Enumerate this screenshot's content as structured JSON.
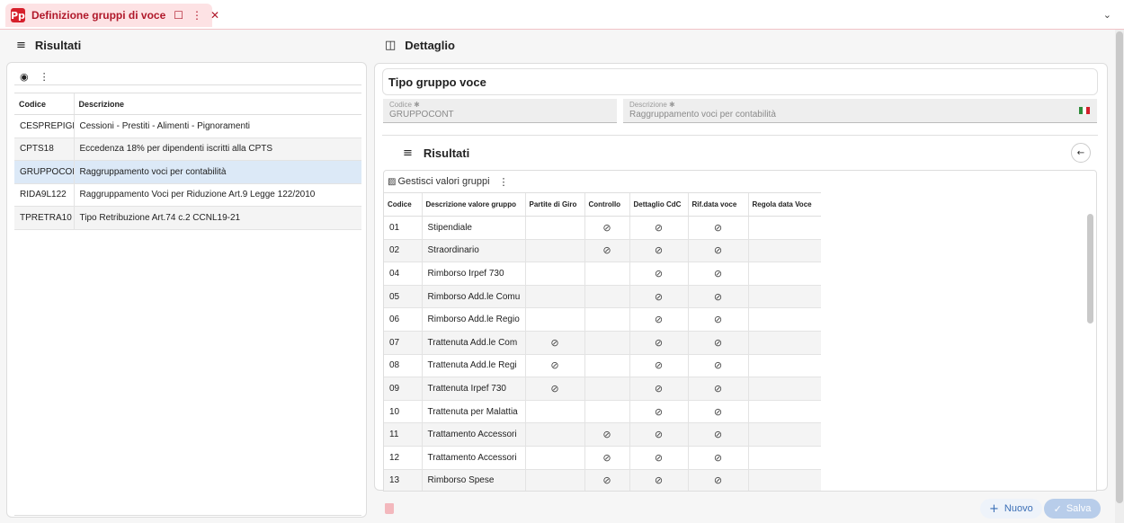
{
  "tab": {
    "logo": "Pp",
    "title": "Definizione gruppi di voce",
    "bookmark_icon": "bookmark-icon",
    "menu_icon": "more-vert-icon",
    "close_icon": "close-icon"
  },
  "left_pane": {
    "title": "Risultati",
    "columns": [
      "Codice",
      "Descrizione"
    ],
    "rows": [
      {
        "codice": "CESPREPIGN",
        "descrizione": "Cessioni - Prestiti - Alimenti - Pignoramenti"
      },
      {
        "codice": "CPTS18",
        "descrizione": "Eccedenza 18% per dipendenti iscritti alla CPTS"
      },
      {
        "codice": "GRUPPOCONT",
        "descrizione": "Raggruppamento voci per contabilità"
      },
      {
        "codice": "RIDA9L122",
        "descrizione": "Raggruppamento Voci per Riduzione Art.9 Legge 122/2010"
      },
      {
        "codice": "TPRETRA10",
        "descrizione": "Tipo Retribuzione Art.74 c.2 CCNL19-21"
      }
    ],
    "selected_index": 2
  },
  "detail_pane": {
    "title": "Dettaglio",
    "section_title": "Tipo gruppo voce",
    "codice_label": "Codice ✱",
    "codice_value": "GRUPPOCONT",
    "descrizione_label": "Descrizione ✱",
    "descrizione_value": "Raggruppamento voci per contabilità"
  },
  "results": {
    "title": "Risultati",
    "manage_label": "Gestisci valori gruppi",
    "columns": [
      "Codice",
      "Descrizione valore gruppo",
      "Partite di Giro",
      "Controllo",
      "Dettaglio CdC",
      "Rif.data voce",
      "Regola data Voce"
    ],
    "rows": [
      {
        "codice": "01",
        "descrizione": "Stipendiale",
        "partite": false,
        "controllo": true,
        "cdc": true,
        "rif": true
      },
      {
        "codice": "02",
        "descrizione": "Straordinario",
        "partite": false,
        "controllo": true,
        "cdc": true,
        "rif": true
      },
      {
        "codice": "04",
        "descrizione": "Rimborso Irpef 730",
        "partite": false,
        "controllo": false,
        "cdc": true,
        "rif": true
      },
      {
        "codice": "05",
        "descrizione": "Rimborso Add.le Comu",
        "partite": false,
        "controllo": false,
        "cdc": true,
        "rif": true
      },
      {
        "codice": "06",
        "descrizione": "Rimborso Add.le Regio",
        "partite": false,
        "controllo": false,
        "cdc": true,
        "rif": true
      },
      {
        "codice": "07",
        "descrizione": "Trattenuta Add.le Com",
        "partite": true,
        "controllo": false,
        "cdc": true,
        "rif": true
      },
      {
        "codice": "08",
        "descrizione": "Trattenuta Add.le Regi",
        "partite": true,
        "controllo": false,
        "cdc": true,
        "rif": true
      },
      {
        "codice": "09",
        "descrizione": "Trattenuta Irpef 730",
        "partite": true,
        "controllo": false,
        "cdc": true,
        "rif": true
      },
      {
        "codice": "10",
        "descrizione": "Trattenuta per Malattia",
        "partite": false,
        "controllo": false,
        "cdc": true,
        "rif": true
      },
      {
        "codice": "11",
        "descrizione": "Trattamento Accessori",
        "partite": false,
        "controllo": true,
        "cdc": true,
        "rif": true
      },
      {
        "codice": "12",
        "descrizione": "Trattamento Accessori",
        "partite": false,
        "controllo": true,
        "cdc": true,
        "rif": true
      },
      {
        "codice": "13",
        "descrizione": "Rimborso Spese",
        "partite": false,
        "controllo": true,
        "cdc": true,
        "rif": true
      }
    ]
  },
  "actions": {
    "nuovo_label": "Nuovo",
    "salva_label": "Salva"
  },
  "colors": {
    "brand": "#d61f2b",
    "selected_row": "#dce9f7",
    "primary": "#3b6fb6"
  }
}
